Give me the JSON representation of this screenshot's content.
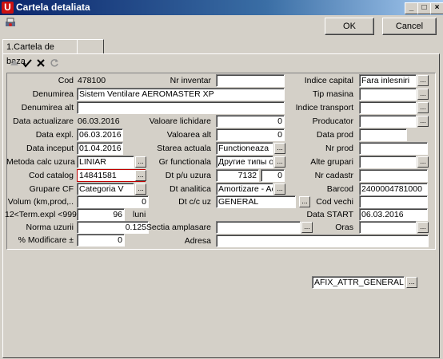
{
  "window": {
    "title": "Cartela detaliata",
    "icon": "app-logo-icon"
  },
  "buttons": {
    "ok": "OK",
    "cancel": "Cancel"
  },
  "tabs": [
    {
      "label": "1.Cartela de baza"
    },
    {
      "label": ""
    }
  ],
  "toolbar": {
    "icons": [
      "up-arrow-icon",
      "check-icon",
      "delete-icon",
      "refresh-icon"
    ]
  },
  "fields": {
    "cod": {
      "label": "Cod",
      "value": "478100"
    },
    "nr_inventar": {
      "label": "Nr inventar",
      "value": ""
    },
    "indice_capital": {
      "label": "Indice capital",
      "value": "Fara inlesniri"
    },
    "denumirea": {
      "label": "Denumirea",
      "value": "Sistem Ventilare AEROMASTER XP"
    },
    "tip_masina": {
      "label": "Tip masina",
      "value": ""
    },
    "denumirea_alt": {
      "label": "Denumirea alt",
      "value": ""
    },
    "indice_transport": {
      "label": "Indice transport",
      "value": ""
    },
    "data_actualizare": {
      "label": "Data actualizare",
      "value": "06.03.2016"
    },
    "valoare_lichidare": {
      "label": "Valoare lichidare",
      "value": "0"
    },
    "producator": {
      "label": "Producator",
      "value": ""
    },
    "data_expl": {
      "label": "Data expl.",
      "value": "06.03.2016"
    },
    "valoarea_alt": {
      "label": "Valoarea alt",
      "value": "0"
    },
    "data_prod": {
      "label": "Data prod",
      "value": ""
    },
    "data_inceput": {
      "label": "Data inceput",
      "value": "01.04.2016"
    },
    "starea_actuala": {
      "label": "Starea actuala",
      "value": "Functioneaza"
    },
    "nr_prod": {
      "label": "Nr prod",
      "value": ""
    },
    "metoda_calc_uzura": {
      "label": "Metoda calc uzura",
      "value": "LINIAR"
    },
    "gr_functionala": {
      "label": "Gr functionala",
      "value": "Другие типы о"
    },
    "alte_grupari": {
      "label": "Alte grupari",
      "value": ""
    },
    "cod_catalog": {
      "label": "Cod catalog",
      "value": "14841581"
    },
    "dt_pu_uzura": {
      "label": "Dt p/u uzura",
      "value": "7132",
      "value2": "0"
    },
    "nr_cadastr": {
      "label": "Nr cadastr",
      "value": ""
    },
    "grupare_cf": {
      "label": "Grupare CF",
      "value": "Categoria V"
    },
    "dt_analitica": {
      "label": "Dt analitica",
      "value": "Amortizare - Acti"
    },
    "barcod": {
      "label": "Barcod",
      "value": "2400004781000"
    },
    "volum": {
      "label": "Volum (km,prod,..",
      "value": "0"
    },
    "dt_cc_uz": {
      "label": "Dt c/c uz",
      "value": "GENERAL"
    },
    "cod_vechi": {
      "label": "Cod vechi",
      "value": ""
    },
    "term_expl": {
      "label": "12<Term.expl <999",
      "value": "96",
      "unit": "luni"
    },
    "data_start": {
      "label": "Data START",
      "value": "06.03.2016"
    },
    "norma_uzurii": {
      "label": "Norma uzurii",
      "value": "0.125"
    },
    "sectia_amplasare": {
      "label": "Sectia amplasare",
      "value": ""
    },
    "oras": {
      "label": "Oras",
      "value": ""
    },
    "modificare": {
      "label": "% Modificare ±",
      "value": "0"
    },
    "adresa": {
      "label": "Adresa",
      "value": ""
    }
  },
  "bottom": {
    "afix": "AFIX_ATTR_GENERAL"
  },
  "ellipsis": "..."
}
